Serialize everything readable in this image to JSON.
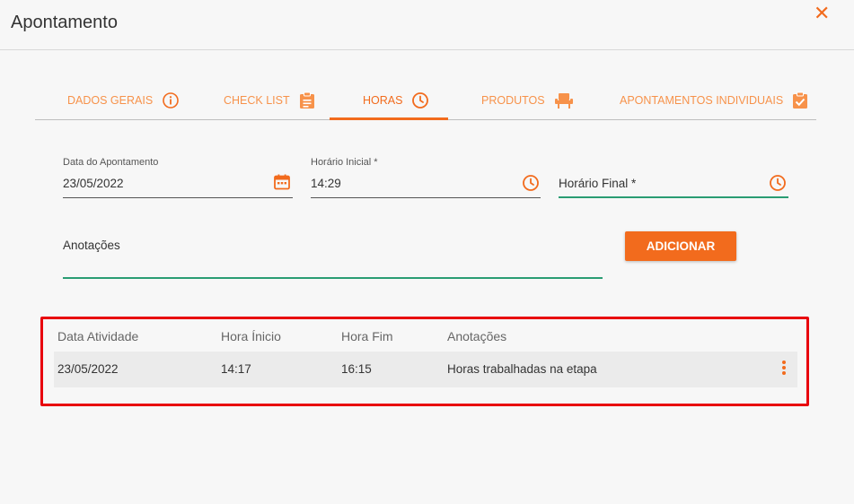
{
  "dialog": {
    "title": "Apontamento",
    "close_label": "✕"
  },
  "tabs": [
    {
      "label": "DADOS GERAIS",
      "icon": "info-icon",
      "active": false
    },
    {
      "label": "CHECK LIST",
      "icon": "clipboard-icon",
      "active": false
    },
    {
      "label": "HORAS",
      "icon": "clock-icon",
      "active": true
    },
    {
      "label": "PRODUTOS",
      "icon": "chair-icon",
      "active": false
    },
    {
      "label": "APONTAMENTOS INDIVIDUAIS",
      "icon": "clipboard-check-icon",
      "active": false
    }
  ],
  "form": {
    "date": {
      "label": "Data do Apontamento",
      "value": "23/05/2022",
      "icon": "calendar-icon"
    },
    "start_time": {
      "label": "Horário Inicial *",
      "value": "14:29",
      "icon": "clock-icon"
    },
    "end_time": {
      "placeholder": "Horário Final *",
      "value": "",
      "icon": "clock-icon"
    },
    "notes": {
      "placeholder": "Anotações",
      "value": ""
    },
    "add_button": "ADICIONAR"
  },
  "table": {
    "columns": [
      "Data Atividade",
      "Hora Ínicio",
      "Hora Fim",
      "Anotações"
    ],
    "rows": [
      {
        "date": "23/05/2022",
        "start": "14:17",
        "end": "16:15",
        "notes": "Horas trabalhadas na etapa"
      }
    ],
    "row_menu_icon": "kebab-menu-icon"
  },
  "colors": {
    "accent": "#f26b1d",
    "accent_light": "#f7924a",
    "focus_green": "#2a9d73",
    "highlight": "#e8000d"
  }
}
